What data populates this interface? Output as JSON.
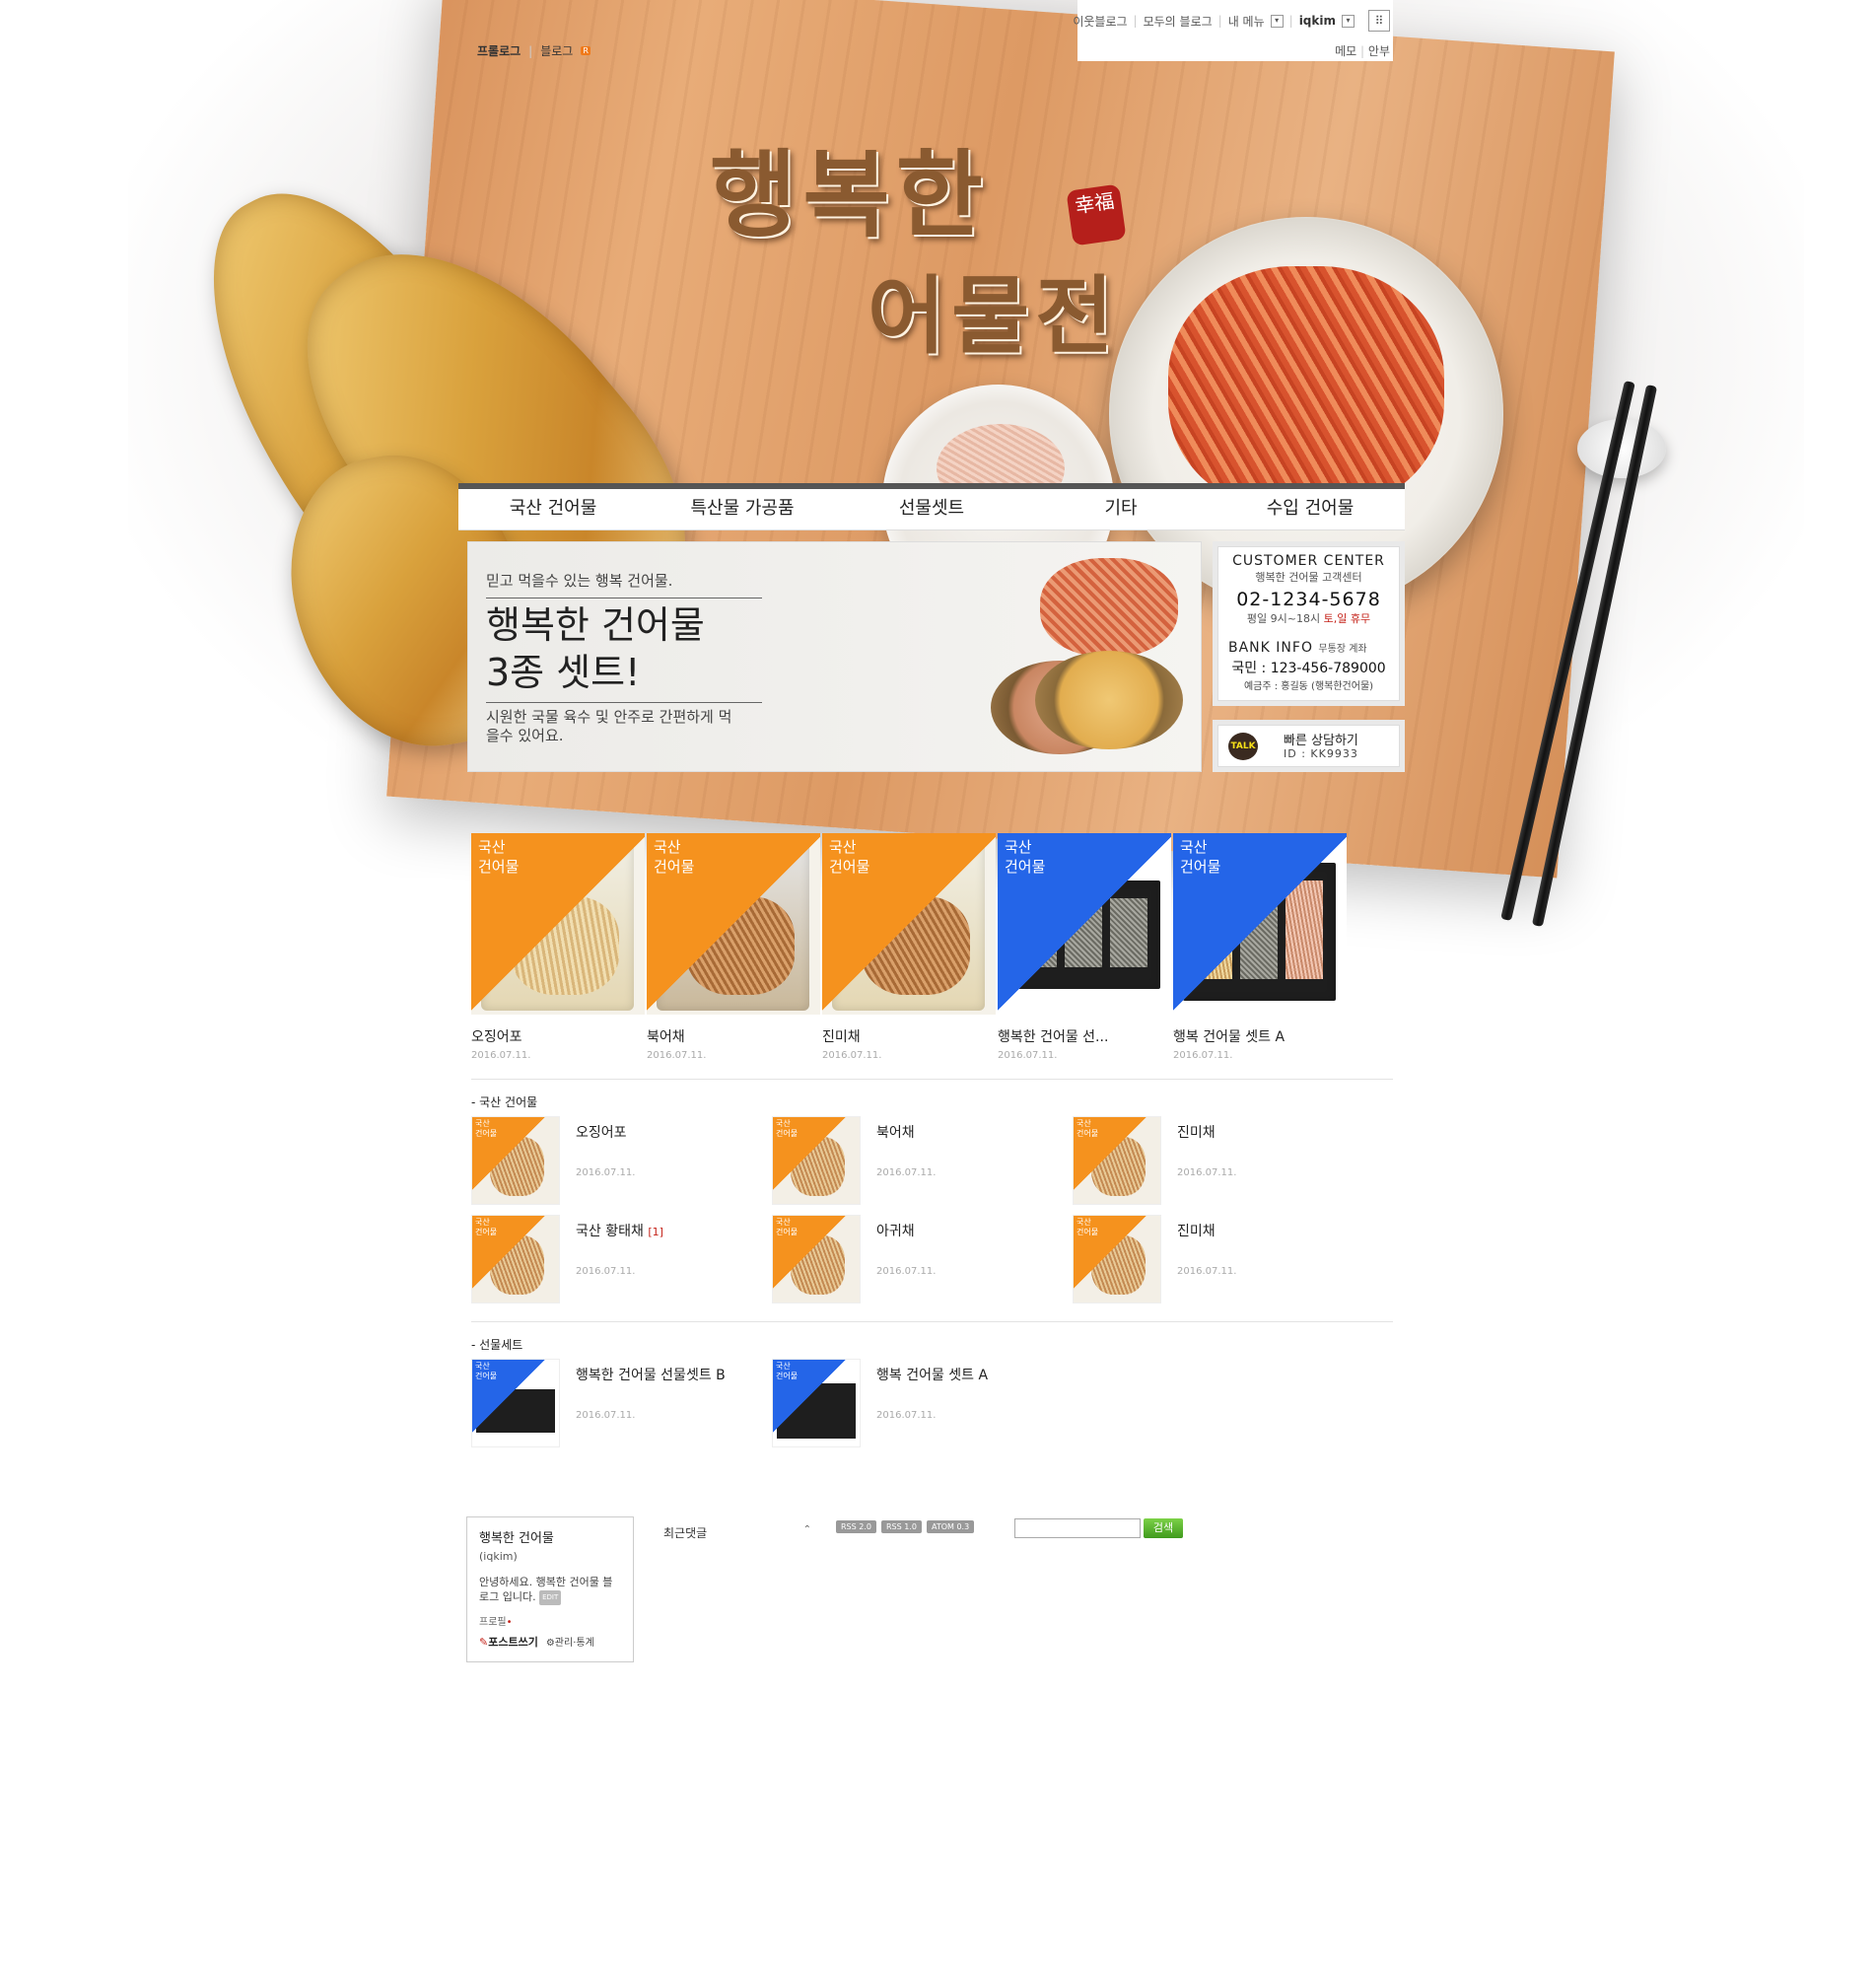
{
  "util": {
    "neighbor_blog": "이웃블로그",
    "all_blogs": "모두의 블로그",
    "my_menu": "내 메뉴",
    "user_id": "iqkim",
    "memo": "메모",
    "anbu": "안부"
  },
  "tabs": {
    "prologue": "프롤로그",
    "blog": "블로그",
    "rss_badge": "R"
  },
  "hero": {
    "title_line1": "행복한",
    "title_line2": "어물전",
    "seal_chars": "幸福"
  },
  "nav": [
    "국산 건어물",
    "특산물 가공품",
    "선물셋트",
    "기타",
    "수입 건어물"
  ],
  "banner": {
    "subtitle": "믿고 먹을수 있는 행복 건어물.",
    "headline1": "행복한 건어물",
    "headline2": "3종 셋트!",
    "desc": "시원한 국물 육수 및 안주로 간편하게 먹을수 있어요."
  },
  "customer_center": {
    "title": "CUSTOMER CENTER",
    "subtitle": "행복한 건어물 고객센터",
    "phone": "02-1234-5678",
    "hours": "평일 9시~18시",
    "closed": "토,일 휴무",
    "bank_title": "BANK INFO",
    "bank_sub": "무통장 계좌",
    "account": "국민 : 123-456-789000",
    "holder": "예금주 : 홍길동 (행복한건어물)"
  },
  "talk": {
    "icon_text": "TALK",
    "label": "빠른 상담하기",
    "id": "ID : KK9933"
  },
  "featured": [
    {
      "badge": "국산\n건어물",
      "title": "오징어포",
      "date": "2016.07.11.",
      "color": "#f5921e"
    },
    {
      "badge": "국산\n건어물",
      "title": "북어채",
      "date": "2016.07.11.",
      "color": "#f5921e"
    },
    {
      "badge": "국산\n건어물",
      "title": "진미채",
      "date": "2016.07.11.",
      "color": "#f5921e"
    },
    {
      "badge": "국산\n건어물",
      "title": "행복한 건어물 선...",
      "date": "2016.07.11.",
      "color": "#2465e8"
    },
    {
      "badge": "국산\n건어물",
      "title": "행복 건어물 셋트 A",
      "date": "2016.07.11.",
      "color": "#2465e8"
    }
  ],
  "section1": {
    "title": "- 국산 건어물",
    "items": [
      {
        "title": "오징어포",
        "count": "",
        "date": "2016.07.11."
      },
      {
        "title": "북어채",
        "count": "",
        "date": "2016.07.11."
      },
      {
        "title": "진미채",
        "count": "",
        "date": "2016.07.11."
      },
      {
        "title": "국산 황태채",
        "count": "[1]",
        "date": "2016.07.11."
      },
      {
        "title": "아귀채",
        "count": "",
        "date": "2016.07.11."
      },
      {
        "title": "진미채",
        "count": "",
        "date": "2016.07.11."
      }
    ]
  },
  "section2": {
    "title": "- 선물세트",
    "items": [
      {
        "title": "행복한 건어물 선물셋트 B",
        "date": "2016.07.11."
      },
      {
        "title": "행복 건어물 셋트 A",
        "date": "2016.07.11."
      }
    ]
  },
  "small_badge": "국산\n건어물",
  "footer": {
    "profile_name": "행복한 건어물",
    "profile_id": "(iqkim)",
    "profile_intro": "안녕하세요. 행복한 건어물 블로그 입니다.",
    "edit": "EDIT",
    "profile_link": "프로필",
    "write": "포스트쓰기",
    "manage": "관리·통계",
    "recent_comments": "최근댓글",
    "feeds": [
      "RSS 2.0",
      "RSS 1.0",
      "ATOM 0.3"
    ],
    "search_button": "검색"
  }
}
